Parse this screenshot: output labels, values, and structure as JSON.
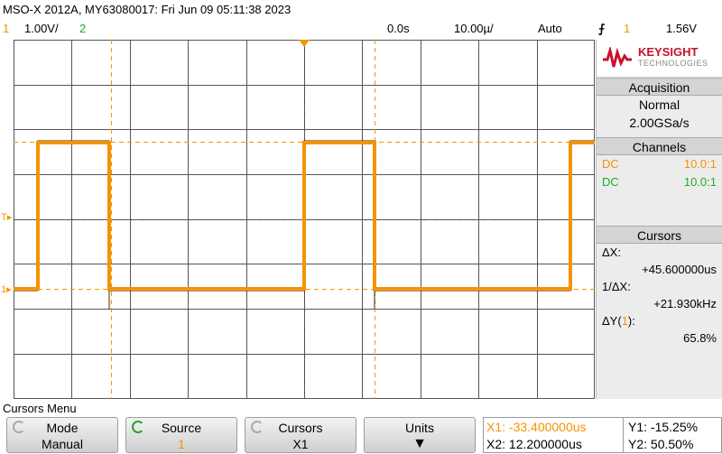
{
  "title": "MSO-X 2012A, MY63080017: Fri Jun 09 05:11:38 2023",
  "status": {
    "ch1_num": "1",
    "ch1_scale": "1.00V/",
    "ch2_num": "2",
    "delay": "0.0s",
    "timebase": "10.00µ/",
    "trigger_mode": "Auto",
    "trigger_source": "1",
    "trigger_level": "1.56V"
  },
  "brand": {
    "name": "KEYSIGHT",
    "sub": "TECHNOLOGIES"
  },
  "acquisition": {
    "heading": "Acquisition",
    "mode": "Normal",
    "rate": "2.00GSa/s"
  },
  "channels": {
    "heading": "Channels",
    "ch1_coupling": "DC",
    "ch1_probe": "10.0:1",
    "ch2_coupling": "DC",
    "ch2_probe": "10.0:1"
  },
  "cursors": {
    "heading": "Cursors",
    "dx_label": "ΔX:",
    "dx_value": "+45.600000us",
    "inv_dx_label": "1/ΔX:",
    "inv_dx_value": "+21.930kHz",
    "dy_label_pre": "ΔY(",
    "dy_label_ch": "1",
    "dy_label_post": "):",
    "dy_value": "65.8%"
  },
  "menu": {
    "label": "Cursors Menu",
    "mode_label": "Mode",
    "mode_value": "Manual",
    "source_label": "Source",
    "source_value": "1",
    "cursors_label": "Cursors",
    "cursors_value": "X1",
    "units_label": "Units"
  },
  "readout": {
    "x1": "X1: -33.400000us",
    "x2": "X2: 12.200000us",
    "y1": "Y1: -15.25%",
    "y2": "Y2: 50.50%"
  },
  "colors": {
    "ch1": "#f59300",
    "ch2": "#1fae1f",
    "brand": "#c8102e"
  }
}
